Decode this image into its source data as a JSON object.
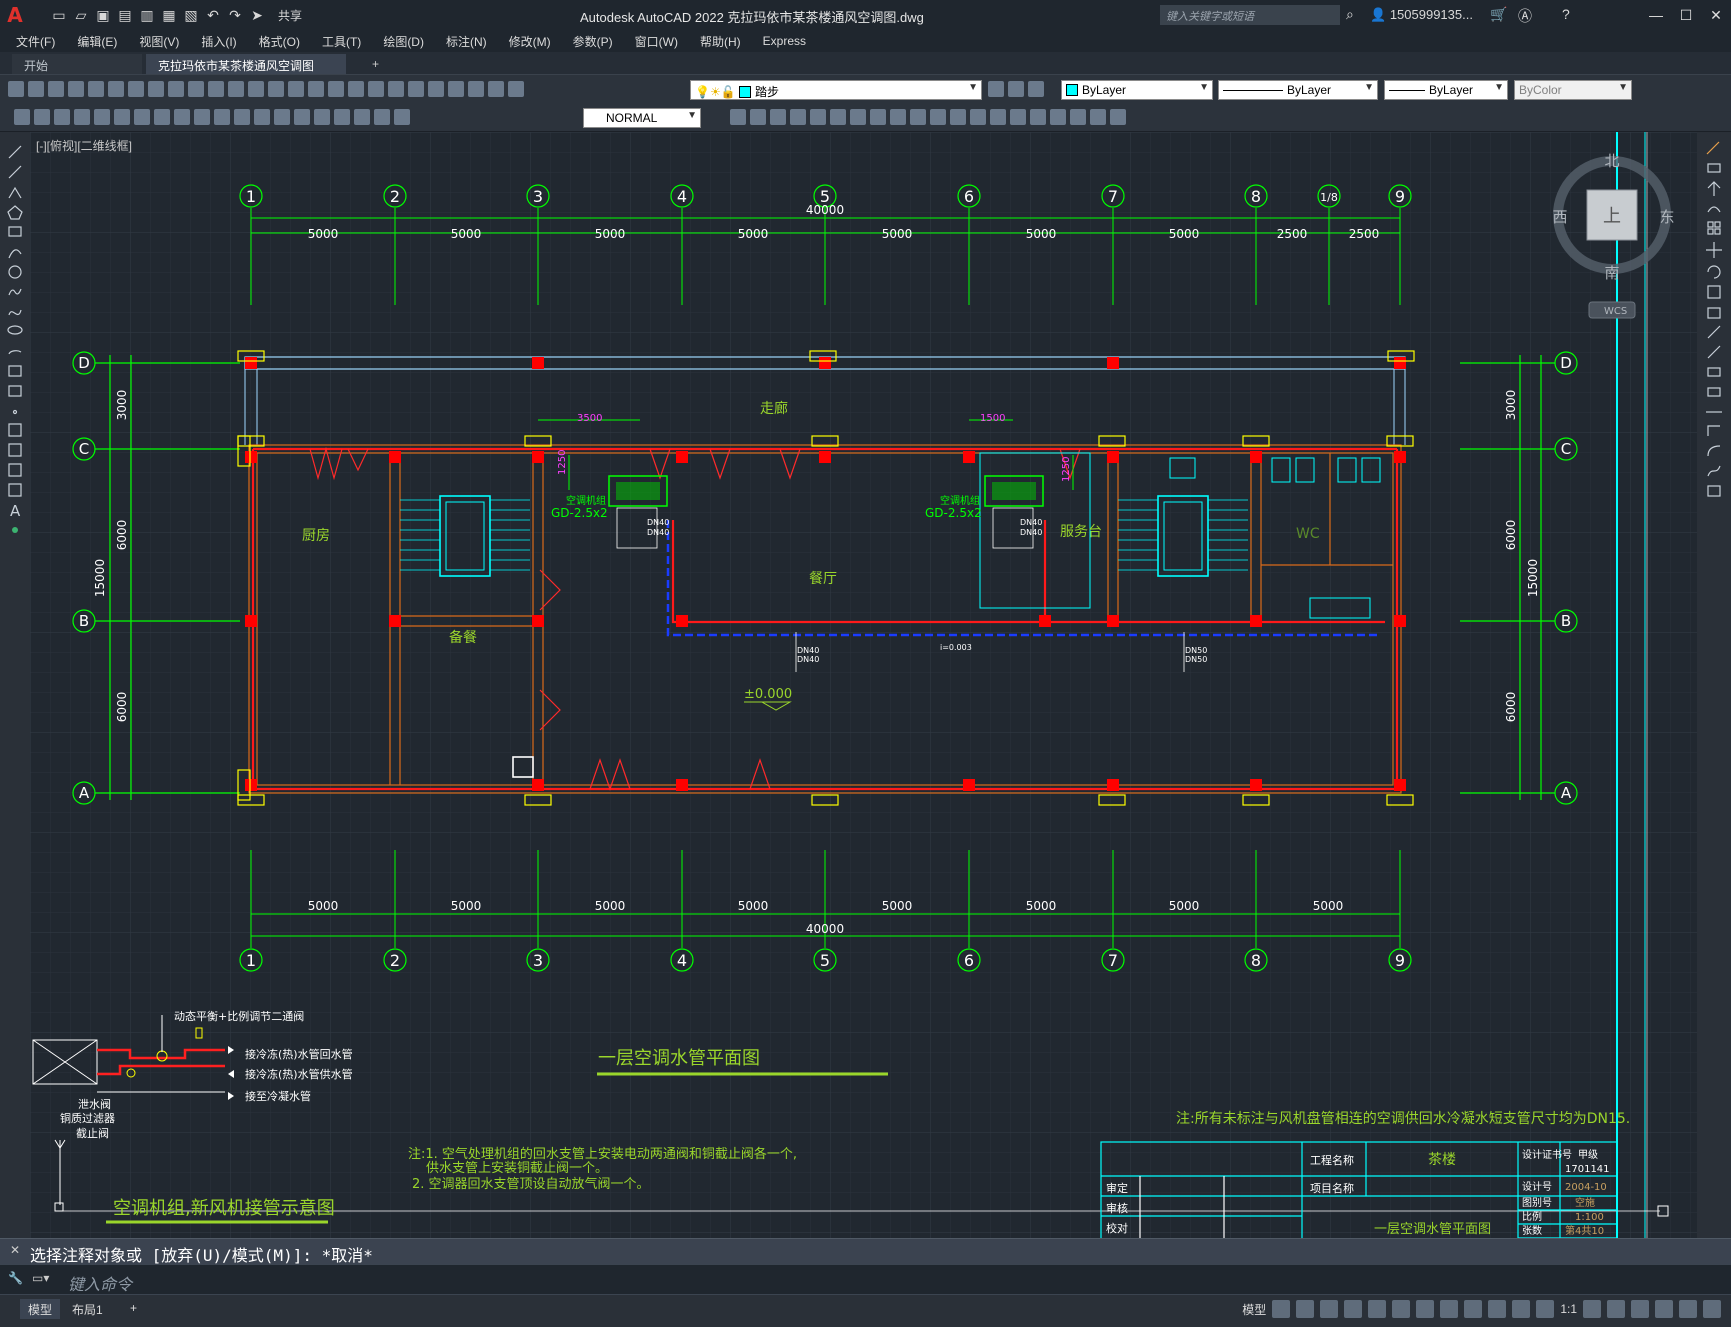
{
  "app": {
    "window_title": "Autodesk AutoCAD 2022    克拉玛依市某茶楼通风空调图.dwg",
    "search_placeholder": "键入关键字或短语",
    "user": "1505999135...",
    "share": "共享"
  },
  "menu": [
    "文件(F)",
    "编辑(E)",
    "视图(V)",
    "插入(I)",
    "格式(O)",
    "工具(T)",
    "绘图(D)",
    "标注(N)",
    "修改(M)",
    "参数(P)",
    "窗口(W)",
    "帮助(H)",
    "Express"
  ],
  "tabs": {
    "start": "开始",
    "active": "克拉玛依市某茶楼通风空调图*"
  },
  "properties": {
    "layer": "踏步",
    "color": "ByLayer",
    "linetype": "ByLayer",
    "lineweight": "ByLayer",
    "plotstyle": "ByColor",
    "dimstyle": "NORMAL"
  },
  "viewport_label": "[-][俯视][二维线框]",
  "viewcube": {
    "north": "北",
    "south": "南",
    "east": "东",
    "west": "西",
    "top": "上",
    "wcs": "WCS"
  },
  "drawing": {
    "axes_x": [
      "1",
      "2",
      "3",
      "4",
      "5",
      "6",
      "7",
      "8",
      "1/8",
      "9"
    ],
    "axes_y": [
      "D",
      "C",
      "B",
      "A"
    ],
    "dims_top": [
      "5000",
      "5000",
      "5000",
      "5000",
      "5000",
      "5000",
      "5000",
      "2500",
      "2500"
    ],
    "dims_bottom": [
      "5000",
      "5000",
      "5000",
      "5000",
      "5000",
      "5000",
      "5000",
      "5000"
    ],
    "total": "40000",
    "dims_y": [
      "3000",
      "6000",
      "6000"
    ],
    "total_y": "15000",
    "rooms": {
      "corridor": "走廊",
      "kitchen": "厨房",
      "prep": "备餐",
      "dining": "餐厅",
      "service": "服务台",
      "wc": "WC"
    },
    "ahu_label": "空调机组",
    "ahu_model": "GD-2.5x2",
    "pipe_dn40": "DN40",
    "pipe_dn50": "DN50",
    "slope": "i=0.003",
    "elev": "±0.000",
    "dim_3500": "3500",
    "dim_1500": "1500",
    "dim_1250": "1250",
    "plan_title": "一层空调水管平面图",
    "schematic_title": "空调机组,新风机接管示意图",
    "schematic_labels": [
      "动态平衡+比例调节二通阀",
      "接冷冻(热)水管回水管",
      "接冷冻(热)水管供水管",
      "接至冷凝水管",
      "泄水阀",
      "铜质过滤器",
      "截止阀"
    ],
    "note_main_1": "注:1. 空气处理机组的回水支管上安装电动两通阀和铜截止阀各一个,",
    "note_main_2": "供水支管上安装铜截止阀一个。",
    "note_main_3": "2. 空调器回水支管顶设自动放气阀一个。",
    "note_right": "注:所有未标注与风机盘管相连的空调供回水冷凝水短支管尺寸均为DN15.",
    "titleblock": {
      "project_name_lbl": "工程名称",
      "project_name": "茶楼",
      "item_name_lbl": "项目名称",
      "cert_lbl": "设计证书号",
      "grade": "甲级",
      "cert_no": "1701141",
      "approve": "审定",
      "review": "审核",
      "check": "校对",
      "design_no_lbl": "设计号",
      "design_no": "2004-10",
      "drawing_type_lbl": "图别号",
      "drawing_type": "空施",
      "scale_lbl": "比例",
      "scale": "1:100",
      "sheet_lbl": "张数",
      "sheet": "第4共10",
      "drawing_title": "一层空调水管平面图"
    }
  },
  "command": {
    "history": "选择注释对象或 [放弃(U)/模式(M)]: *取消*",
    "placeholder": "键入命令"
  },
  "status": {
    "model": "模型",
    "layout1": "布局1",
    "scale": "1:1"
  }
}
